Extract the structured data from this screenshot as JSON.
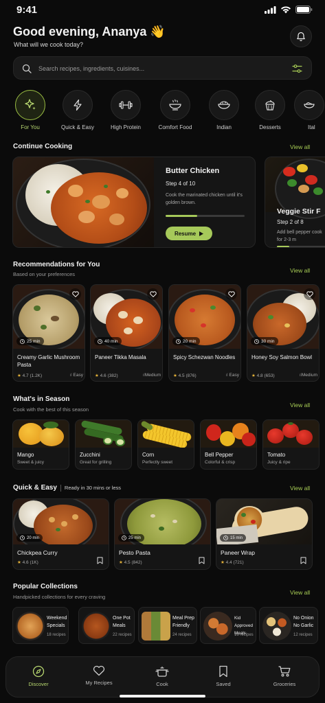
{
  "status": {
    "time": "9:41"
  },
  "header": {
    "greeting": "Good evening, Ananya 👋",
    "subtitle": "What will we cook today?"
  },
  "search": {
    "placeholder": "Search recipes, ingredients, cuisines..."
  },
  "categories": [
    {
      "label": "For You",
      "icon": "sparkle-icon",
      "active": true
    },
    {
      "label": "Quick & Easy",
      "icon": "lightning-icon"
    },
    {
      "label": "High Protein",
      "icon": "dumbbell-icon"
    },
    {
      "label": "Comfort Food",
      "icon": "soup-bowl-icon"
    },
    {
      "label": "Indian",
      "icon": "curry-bowl-icon"
    },
    {
      "label": "Desserts",
      "icon": "cupcake-icon"
    },
    {
      "label": "Ital",
      "icon": "pasta-icon"
    }
  ],
  "continue_cooking": {
    "title": "Continue Cooking",
    "view_all": "View all",
    "cards": [
      {
        "title": "Butter Chicken",
        "step": "Step 4 of 10",
        "instruction": "Cook the marinated chicken until it's golden brown.",
        "progress": 0.4,
        "button": "Resume"
      },
      {
        "title": "Veggie Stir F",
        "step": "Step 2 of 8",
        "instruction": "Add bell pepper cook for 2-3 m",
        "progress": 0.25
      }
    ]
  },
  "recommendations": {
    "title": "Recommendations for You",
    "subtitle": "Based on your preferences",
    "view_all": "View all",
    "items": [
      {
        "name": "Creamy Garlic Mushroom Pasta",
        "time": "25 min",
        "rating": "4.7 (1.2K)",
        "level": "Easy"
      },
      {
        "name": "Paneer Tikka Masala",
        "time": "40 min",
        "rating": "4.6 (382)",
        "level": "Medium"
      },
      {
        "name": "Spicy Schezwan Noodles",
        "time": "20 min",
        "rating": "4.5 (876)",
        "level": "Easy"
      },
      {
        "name": "Honey Soy Salmon Bowl",
        "time": "30 min",
        "rating": "4.8 (653)",
        "level": "Medium"
      }
    ]
  },
  "season": {
    "title": "What's in Season",
    "subtitle": "Cook with the best of this season",
    "view_all": "View all",
    "items": [
      {
        "name": "Mango",
        "desc": "Sweet & juicy"
      },
      {
        "name": "Zucchini",
        "desc": "Great for grilling"
      },
      {
        "name": "Corn",
        "desc": "Perfectly sweet"
      },
      {
        "name": "Bell Pepper",
        "desc": "Colorful & crisp"
      },
      {
        "name": "Tomato",
        "desc": "Juicy & ripe"
      }
    ]
  },
  "quick": {
    "title": "Quick & Easy",
    "subtitle": "Ready in 30 mins or less",
    "view_all": "View all",
    "items": [
      {
        "name": "Chickpea Curry",
        "time": "20 min",
        "rating": "4.6 (1K)"
      },
      {
        "name": "Pesto Pasta",
        "time": "25 min",
        "rating": "4.5 (842)"
      },
      {
        "name": "Paneer Wrap",
        "time": "15 min",
        "rating": "4.4 (721)"
      }
    ]
  },
  "collections": {
    "title": "Popular Collections",
    "subtitle": "Handpicked collections for every craving",
    "view_all": "View all",
    "items": [
      {
        "name": "Weekend Specials",
        "count": "18 recipes"
      },
      {
        "name": "One Pot Meals",
        "count": "22 recipes"
      },
      {
        "name": "Meal Prep Friendly",
        "count": "24 recipes"
      },
      {
        "name": "Kid Approved Meals",
        "count": "16 recipes"
      },
      {
        "name": "No Onion No Garlic",
        "count": "12 recipes"
      }
    ]
  },
  "nav": [
    {
      "label": "Discover",
      "icon": "compass-icon",
      "active": true
    },
    {
      "label": "My Recipes",
      "icon": "heart-icon"
    },
    {
      "label": "Cook",
      "icon": "pot-icon"
    },
    {
      "label": "Saved",
      "icon": "bookmark-icon"
    },
    {
      "label": "Groceries",
      "icon": "cart-icon"
    }
  ],
  "colors": {
    "accent": "#a6c95a",
    "background": "#0b0b0b",
    "card": "#151515",
    "star": "#e7b43a"
  }
}
